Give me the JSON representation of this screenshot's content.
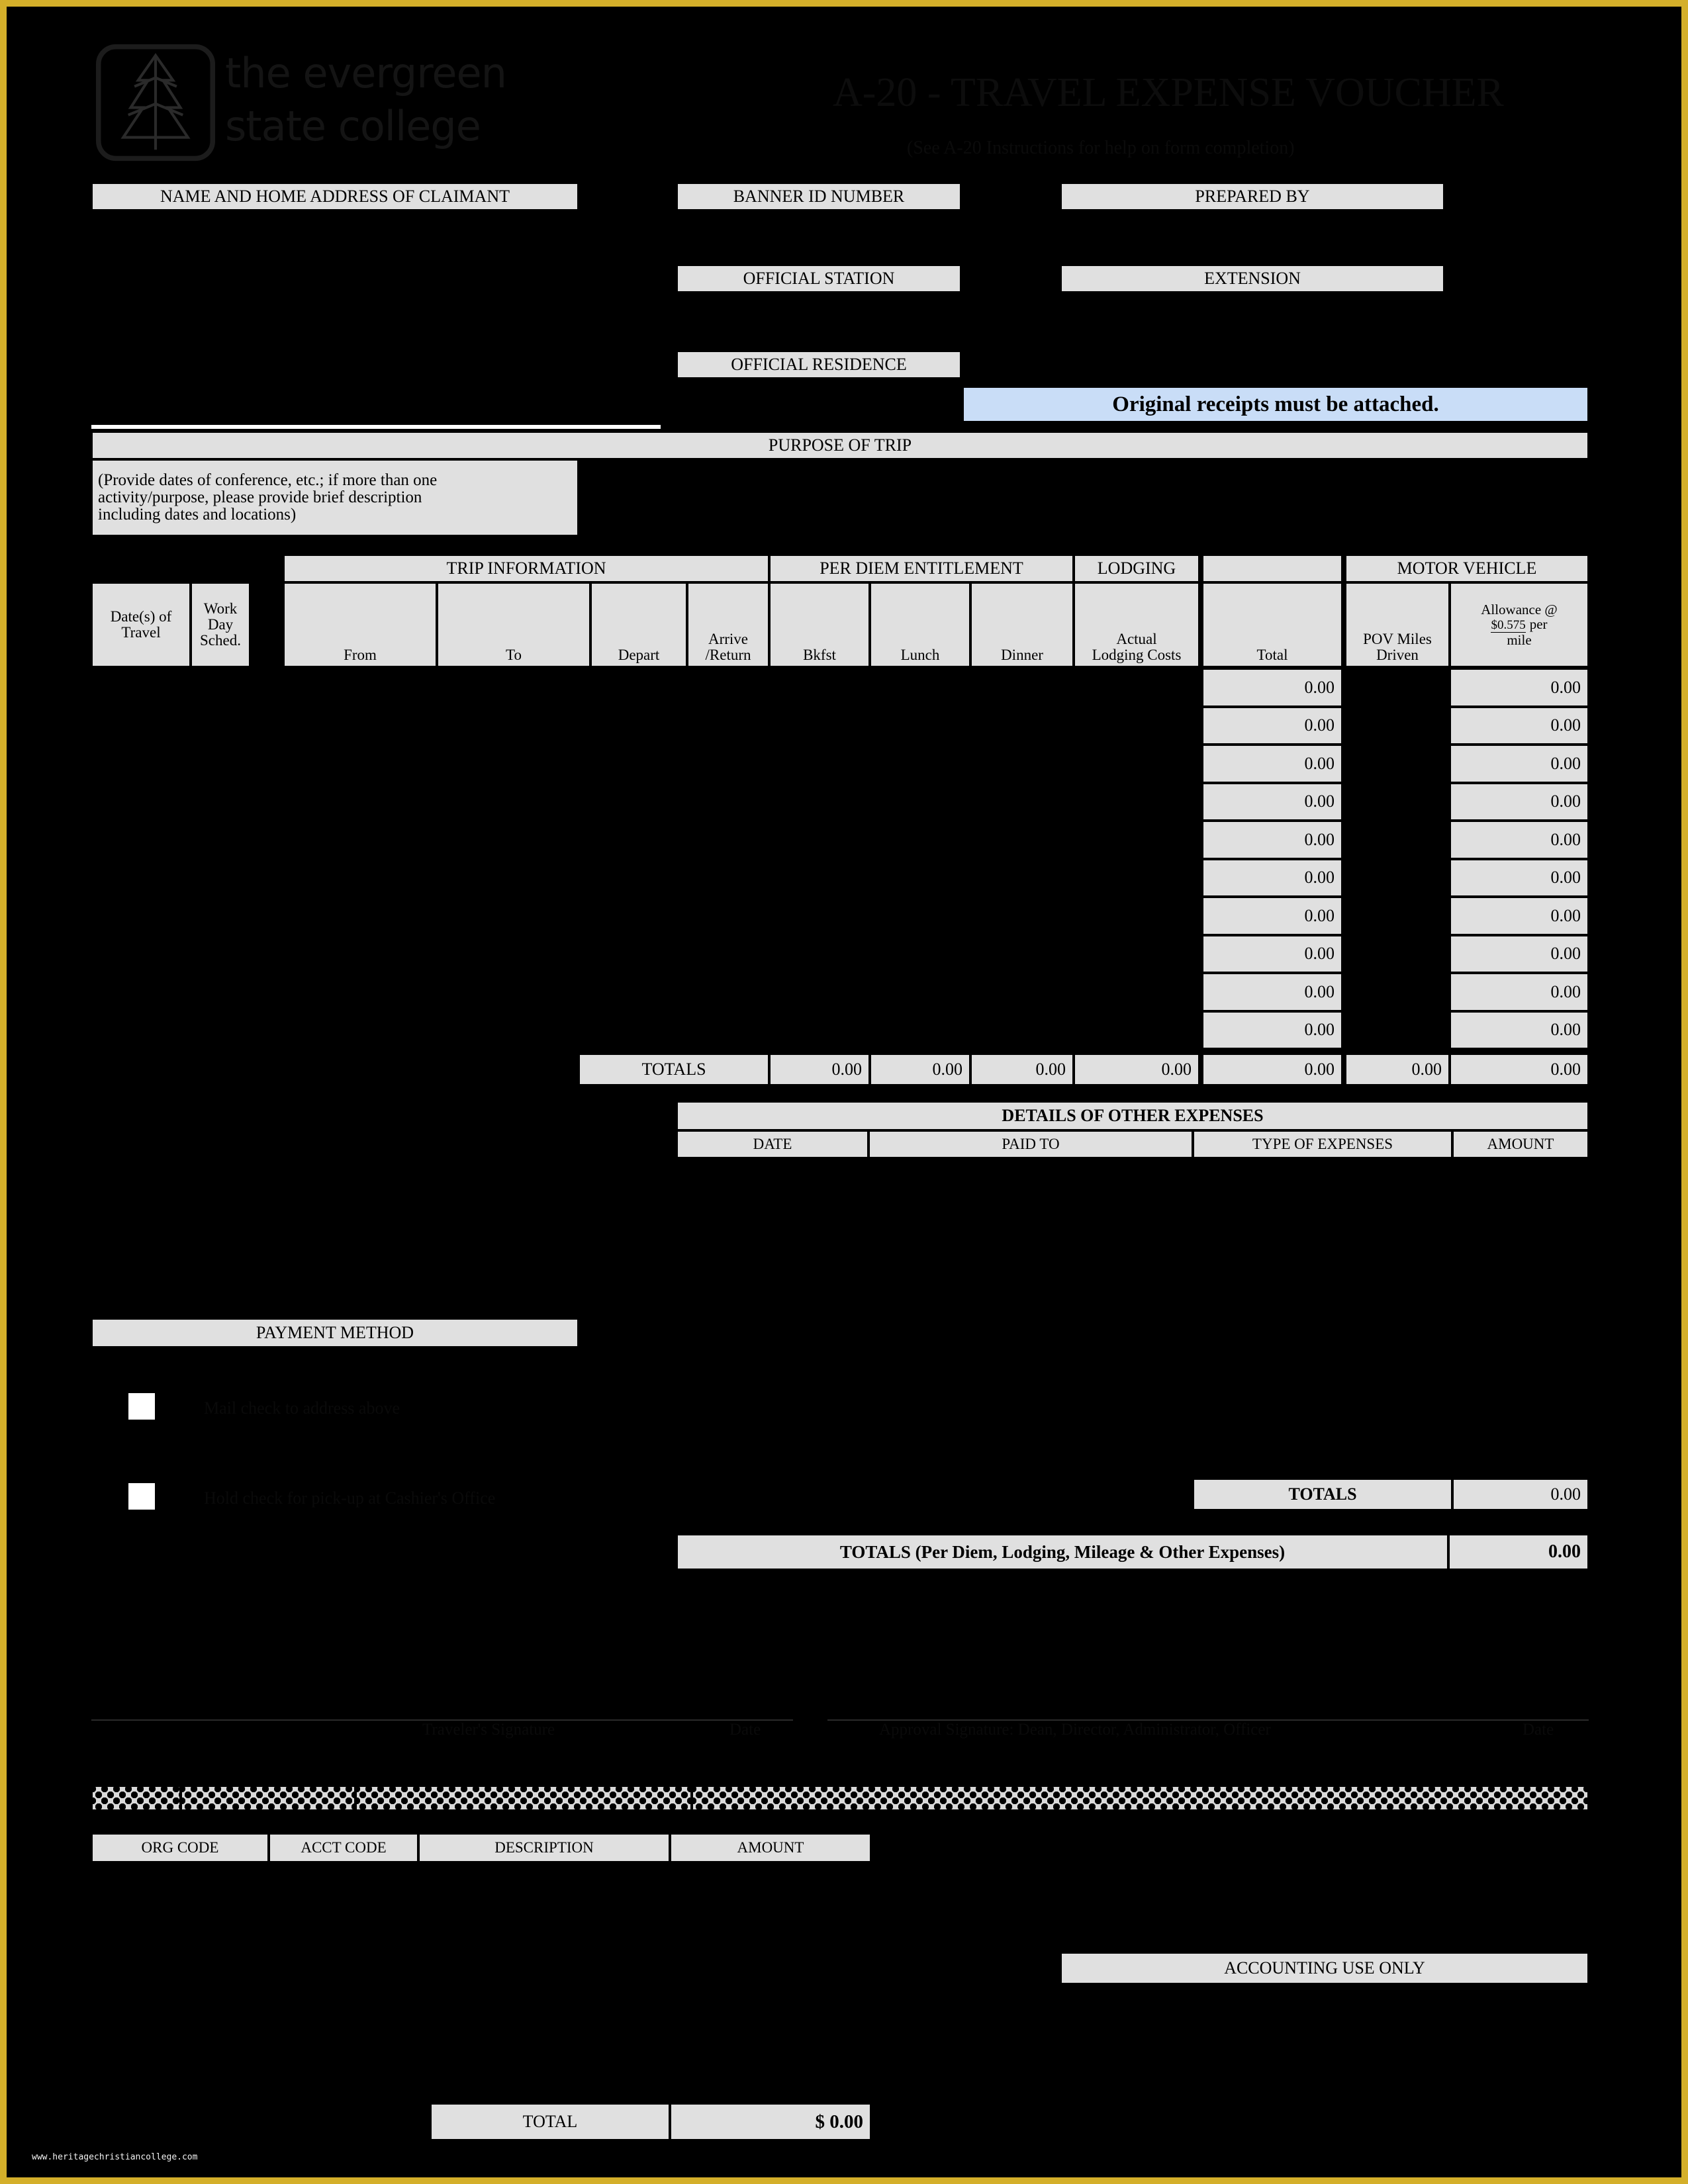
{
  "document": {
    "title": "A-20 - TRAVEL EXPENSE VOUCHER",
    "subtitle": "(See A-20 Instructions for help on form completion)",
    "logo_line1": "the evergreen",
    "logo_line2": "state college",
    "logo_icon": "evergreen-tree-icon",
    "watermark": "www.heritagechristiancollege.com",
    "border_color": "#d4af2a",
    "header_fill": "#e0e0e0",
    "notice_fill": "#c9ddf7"
  },
  "header": {
    "name_address_label": "NAME AND HOME ADDRESS OF CLAIMANT",
    "name_address_value": "",
    "banner_id_label": "BANNER ID NUMBER",
    "banner_id_value": "",
    "prepared_by_label": "PREPARED BY",
    "prepared_by_value": "",
    "official_station_label": "OFFICIAL STATION",
    "official_station_value": "",
    "extension_label": "EXTENSION",
    "extension_value": "",
    "official_residence_label": "OFFICIAL RESIDENCE",
    "official_residence_value": "",
    "receipts_notice": "Original receipts must be attached."
  },
  "purpose": {
    "label": "PURPOSE OF TRIP",
    "hint_line1": "(Provide dates of conference, etc.; if more than one",
    "hint_line2": "activity/purpose, please provide brief description",
    "hint_line3": "including dates and locations)",
    "value": ""
  },
  "trip_table": {
    "group_headers": {
      "trip_information": "TRIP INFORMATION",
      "per_diem": "PER DIEM ENTITLEMENT",
      "lodging": "LODGING",
      "blank": "",
      "motor_vehicle": "MOTOR VEHICLE"
    },
    "columns": [
      "Date(s) of Travel",
      "Work Day Sched.",
      "From",
      "To",
      "Depart",
      "Arrive /Return",
      "Bkfst",
      "Lunch",
      "Dinner",
      "Actual Lodging Costs",
      "Total",
      "POV Miles Driven",
      "Allowance @ $0.575 per mile"
    ],
    "columns_split": {
      "date_line1": "Date(s) of",
      "date_line2": "Travel",
      "work_line1": "Work",
      "work_line2": "Day",
      "work_line3": "Sched.",
      "from": "From",
      "to": "To",
      "depart": "Depart",
      "arrive_line1": "Arrive",
      "arrive_line2": "/Return",
      "bkfst": "Bkfst",
      "lunch": "Lunch",
      "dinner": "Dinner",
      "lodging_line1": "Actual",
      "lodging_line2": "Lodging Costs",
      "total": "Total",
      "pov_line1": "POV Miles",
      "pov_line2": "Driven",
      "allowance_line1": "Allowance @",
      "allowance_rate": "$0.575",
      "allowance_per": "per",
      "allowance_line3": "mile"
    },
    "rows": [
      {
        "date": "",
        "work": "",
        "from": "",
        "to": "",
        "depart": "",
        "arrive": "",
        "bkfst": "",
        "lunch": "",
        "dinner": "",
        "lodging": "",
        "total": "0.00",
        "pov": "",
        "allowance": "0.00"
      },
      {
        "date": "",
        "work": "",
        "from": "",
        "to": "",
        "depart": "",
        "arrive": "",
        "bkfst": "",
        "lunch": "",
        "dinner": "",
        "lodging": "",
        "total": "0.00",
        "pov": "",
        "allowance": "0.00"
      },
      {
        "date": "",
        "work": "",
        "from": "",
        "to": "",
        "depart": "",
        "arrive": "",
        "bkfst": "",
        "lunch": "",
        "dinner": "",
        "lodging": "",
        "total": "0.00",
        "pov": "",
        "allowance": "0.00"
      },
      {
        "date": "",
        "work": "",
        "from": "",
        "to": "",
        "depart": "",
        "arrive": "",
        "bkfst": "",
        "lunch": "",
        "dinner": "",
        "lodging": "",
        "total": "0.00",
        "pov": "",
        "allowance": "0.00"
      },
      {
        "date": "",
        "work": "",
        "from": "",
        "to": "",
        "depart": "",
        "arrive": "",
        "bkfst": "",
        "lunch": "",
        "dinner": "",
        "lodging": "",
        "total": "0.00",
        "pov": "",
        "allowance": "0.00"
      },
      {
        "date": "",
        "work": "",
        "from": "",
        "to": "",
        "depart": "",
        "arrive": "",
        "bkfst": "",
        "lunch": "",
        "dinner": "",
        "lodging": "",
        "total": "0.00",
        "pov": "",
        "allowance": "0.00"
      },
      {
        "date": "",
        "work": "",
        "from": "",
        "to": "",
        "depart": "",
        "arrive": "",
        "bkfst": "",
        "lunch": "",
        "dinner": "",
        "lodging": "",
        "total": "0.00",
        "pov": "",
        "allowance": "0.00"
      },
      {
        "date": "",
        "work": "",
        "from": "",
        "to": "",
        "depart": "",
        "arrive": "",
        "bkfst": "",
        "lunch": "",
        "dinner": "",
        "lodging": "",
        "total": "0.00",
        "pov": "",
        "allowance": "0.00"
      },
      {
        "date": "",
        "work": "",
        "from": "",
        "to": "",
        "depart": "",
        "arrive": "",
        "bkfst": "",
        "lunch": "",
        "dinner": "",
        "lodging": "",
        "total": "0.00",
        "pov": "",
        "allowance": "0.00"
      },
      {
        "date": "",
        "work": "",
        "from": "",
        "to": "",
        "depart": "",
        "arrive": "",
        "bkfst": "",
        "lunch": "",
        "dinner": "",
        "lodging": "",
        "total": "0.00",
        "pov": "",
        "allowance": "0.00"
      }
    ],
    "totals_label": "TOTALS",
    "totals": {
      "bkfst": "0.00",
      "lunch": "0.00",
      "dinner": "0.00",
      "lodging": "0.00",
      "total": "0.00",
      "pov": "0.00",
      "allowance": "0.00"
    }
  },
  "other_expenses": {
    "section_title": "DETAILS OF OTHER EXPENSES",
    "columns": [
      "DATE",
      "PAID TO",
      "TYPE OF EXPENSES",
      "AMOUNT"
    ],
    "rows": [
      {
        "date": "",
        "paid_to": "",
        "type": "",
        "amount": ""
      },
      {
        "date": "",
        "paid_to": "",
        "type": "",
        "amount": ""
      },
      {
        "date": "",
        "paid_to": "",
        "type": "",
        "amount": ""
      },
      {
        "date": "",
        "paid_to": "",
        "type": "",
        "amount": ""
      },
      {
        "date": "",
        "paid_to": "",
        "type": "",
        "amount": ""
      },
      {
        "date": "",
        "paid_to": "",
        "type": "",
        "amount": ""
      },
      {
        "date": "",
        "paid_to": "",
        "type": "",
        "amount": ""
      },
      {
        "date": "",
        "paid_to": "",
        "type": "",
        "amount": ""
      },
      {
        "date": "",
        "paid_to": "",
        "type": "",
        "amount": ""
      },
      {
        "date": "",
        "paid_to": "",
        "type": "",
        "amount": ""
      },
      {
        "date": "",
        "paid_to": "",
        "type": "",
        "amount": ""
      }
    ],
    "totals_label": "TOTALS",
    "totals_amount": "0.00"
  },
  "payment_method": {
    "label": "PAYMENT METHOD",
    "options": [
      {
        "label": "Mail check to address above",
        "checked": false
      },
      {
        "label": "Hold check for pick-up at Cashier's Office",
        "checked": false
      }
    ]
  },
  "grand_total": {
    "label": "TOTALS (Per Diem, Lodging, Mileage & Other Expenses)",
    "amount": "0.00"
  },
  "signatures": {
    "traveler": "Traveler's Signature",
    "date_left": "Date",
    "approval": "Approval Signature: Dean, Director, Administrator, Officer",
    "date_right": "Date"
  },
  "accounting": {
    "section_title": "ACCOUNTING USE ONLY",
    "columns": [
      "ORG CODE",
      "ACCT CODE",
      "DESCRIPTION",
      "AMOUNT"
    ],
    "rows": [
      {
        "org": "",
        "acct": "",
        "description": "",
        "amount": ""
      },
      {
        "org": "",
        "acct": "",
        "description": "",
        "amount": ""
      },
      {
        "org": "",
        "acct": "",
        "description": "",
        "amount": ""
      },
      {
        "org": "",
        "acct": "",
        "description": "",
        "amount": ""
      },
      {
        "org": "",
        "acct": "",
        "description": "",
        "amount": ""
      },
      {
        "org": "",
        "acct": "",
        "description": "",
        "amount": ""
      },
      {
        "org": "",
        "acct": "",
        "description": "",
        "amount": ""
      }
    ],
    "total_label": "TOTAL",
    "total_amount": "$ 0.00"
  }
}
